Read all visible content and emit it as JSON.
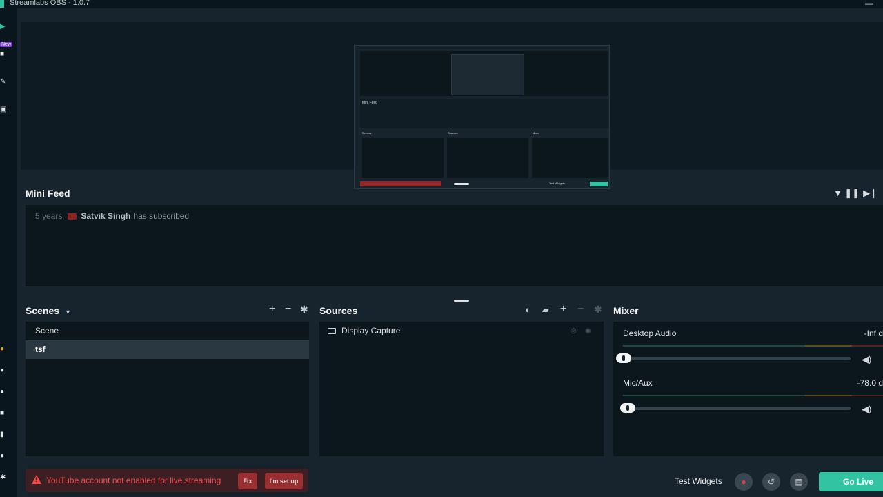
{
  "window": {
    "title": "Streamlabs OBS - 1.0.7",
    "minimize": "—"
  },
  "sidebar": {
    "new_badge": "New"
  },
  "preview": {
    "mini_feed_title": "Mini Feed",
    "scenes_title": "Scenes",
    "sources_title": "Sources",
    "mixer_title": "Mixer",
    "test_widgets": "Test Widgets",
    "go_live": "Go Live"
  },
  "minifeed": {
    "title": "Mini Feed",
    "event": {
      "time": "5 years",
      "name": "Satvik Singh",
      "action": "has subscribed"
    }
  },
  "scenes": {
    "title": "Scenes",
    "items": [
      {
        "label": "Scene",
        "selected": false
      },
      {
        "label": "tsf",
        "selected": true
      }
    ]
  },
  "sources": {
    "title": "Sources",
    "items": [
      {
        "label": "Display Capture"
      }
    ]
  },
  "mixer": {
    "title": "Mixer",
    "channels": [
      {
        "label": "Desktop Audio",
        "level": "-Inf d",
        "volume": 0
      },
      {
        "label": "Mic/Aux",
        "level": "-78.0 d",
        "volume": 0
      }
    ]
  },
  "footer": {
    "warning": "YouTube account not enabled for live streaming",
    "fix_label": "Fix",
    "setup_label": "I'm set up",
    "test_widgets": "Test Widgets",
    "go_live": "Go Live"
  },
  "colors": {
    "accent": "#31c3a2",
    "warning": "#ef4d4d",
    "background": "#17242d",
    "panel": "#0b161d"
  }
}
